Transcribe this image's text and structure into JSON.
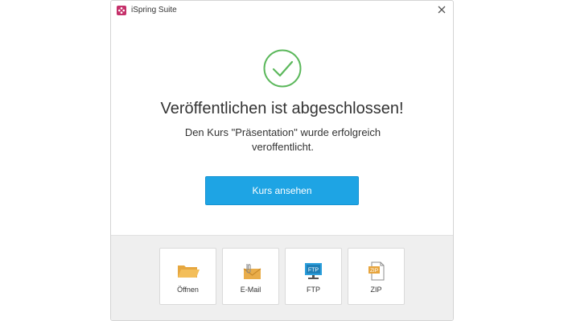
{
  "window": {
    "title": "iSpring Suite",
    "logo": "ispring-flower-icon",
    "close_icon": "close-icon",
    "brand_color": "#c5306a"
  },
  "content": {
    "status_icon": "checkmark-circle-icon",
    "status_color": "#5cb85c",
    "headline": "Veröffentlichen ist abgeschlossen!",
    "message": "Den Kurs \"Präsentation\" wurde erfolgreich veroffentlicht.",
    "primary_button": "Kurs ansehen",
    "primary_color": "#1ea4e4"
  },
  "actions": [
    {
      "label": "Öffnen",
      "icon": "folder-icon"
    },
    {
      "label": "E-Mail",
      "icon": "envelope-icon"
    },
    {
      "label": "FTP",
      "icon": "ftp-monitor-icon",
      "badge": "FTP"
    },
    {
      "label": "ZIP",
      "icon": "zip-file-icon",
      "badge": "ZIP"
    }
  ]
}
